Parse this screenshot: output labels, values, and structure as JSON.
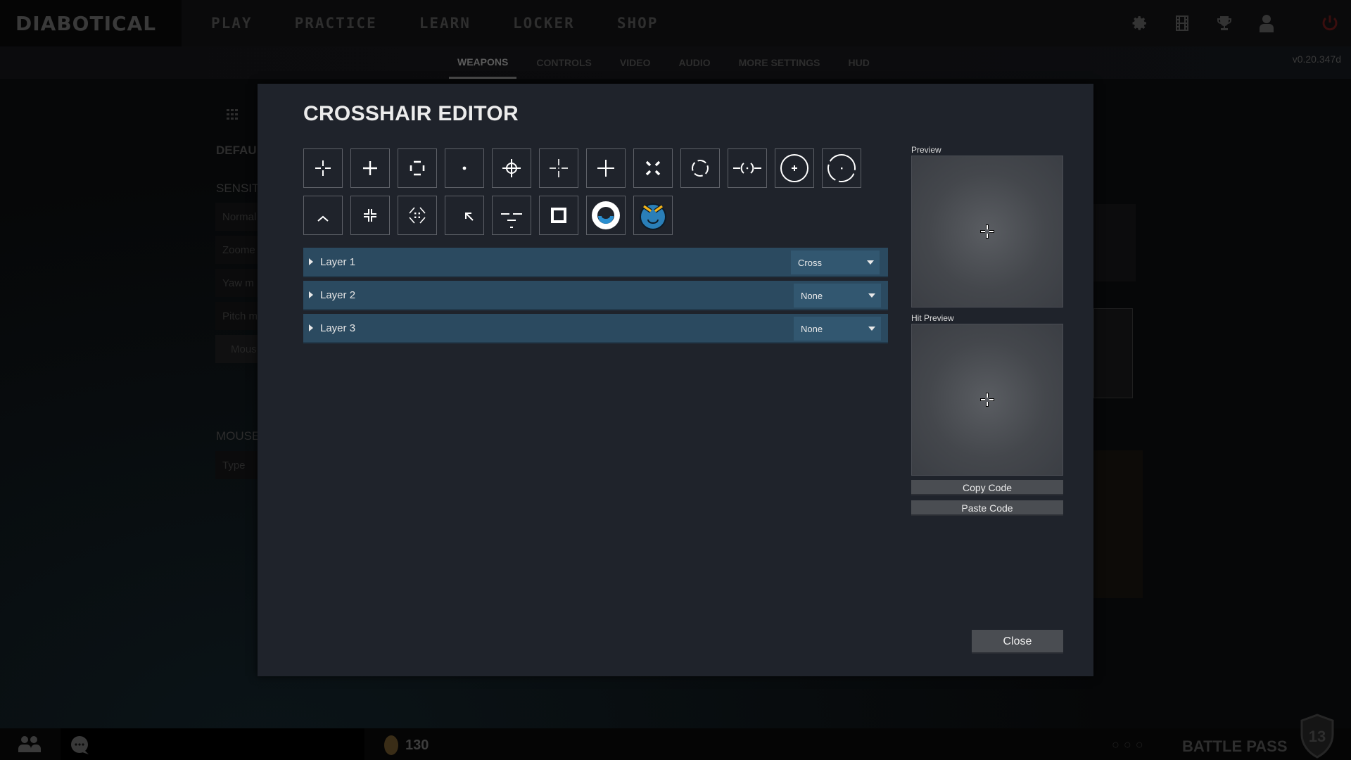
{
  "app": {
    "logo": "DIABOTICAL",
    "version": "v0.20.347d"
  },
  "main_nav": [
    "PLAY",
    "PRACTICE",
    "LEARN",
    "LOCKER",
    "SHOP"
  ],
  "top_icons": [
    "settings-icon",
    "replays-icon",
    "trophy-icon",
    "profile-icon",
    "power-icon"
  ],
  "settings_tabs": [
    {
      "label": "WEAPONS",
      "active": true
    },
    {
      "label": "CONTROLS",
      "active": false
    },
    {
      "label": "VIDEO",
      "active": false
    },
    {
      "label": "AUDIO",
      "active": false
    },
    {
      "label": "MORE SETTINGS",
      "active": false
    },
    {
      "label": "HUD",
      "active": false
    }
  ],
  "background_panel": {
    "heading_default": "DEFAU",
    "heading_sensitivity": "SENSITI",
    "rows": [
      "Normal",
      "Zoome",
      "Yaw m",
      "Pitch m",
      "Mous"
    ],
    "heading_mouse": "MOUSE",
    "mouse_rows": [
      "Type"
    ]
  },
  "bottom_bar": {
    "coins": "130",
    "battle_pass_label": "BATTLE PASS",
    "battle_pass_level": "13"
  },
  "modal": {
    "title": "CROSSHAIR EDITOR",
    "presets": [
      {
        "name": "cross-gap"
      },
      {
        "name": "cross-solid"
      },
      {
        "name": "box-brackets"
      },
      {
        "name": "dot"
      },
      {
        "name": "circle-scope"
      },
      {
        "name": "cross-thin-gap"
      },
      {
        "name": "cross-plus"
      },
      {
        "name": "x-diagonal"
      },
      {
        "name": "circle-segments"
      },
      {
        "name": "bracket-dot-lines"
      },
      {
        "name": "circle-plus"
      },
      {
        "name": "circle-dashed-dot"
      },
      {
        "name": "chevron-up"
      },
      {
        "name": "corner-cross"
      },
      {
        "name": "diamond-dots"
      },
      {
        "name": "arrow-up-left"
      },
      {
        "name": "ladder-lines"
      },
      {
        "name": "square"
      },
      {
        "name": "ring-smile"
      },
      {
        "name": "mascot-face"
      }
    ],
    "layers": [
      {
        "label": "Layer 1",
        "type": "Cross"
      },
      {
        "label": "Layer 2",
        "type": "None"
      },
      {
        "label": "Layer 3",
        "type": "None"
      }
    ],
    "preview_label": "Preview",
    "hit_preview_label": "Hit Preview",
    "copy_code_label": "Copy Code",
    "paste_code_label": "Paste Code",
    "close_label": "Close"
  },
  "colors": {
    "modal_bg": "#1f232b",
    "layer_bg": "#2b4a60",
    "select_bg": "#325770",
    "button_bg": "#4a4d52",
    "icon_blue": "#2a8fd0",
    "icon_yellow": "#f2b21a"
  }
}
